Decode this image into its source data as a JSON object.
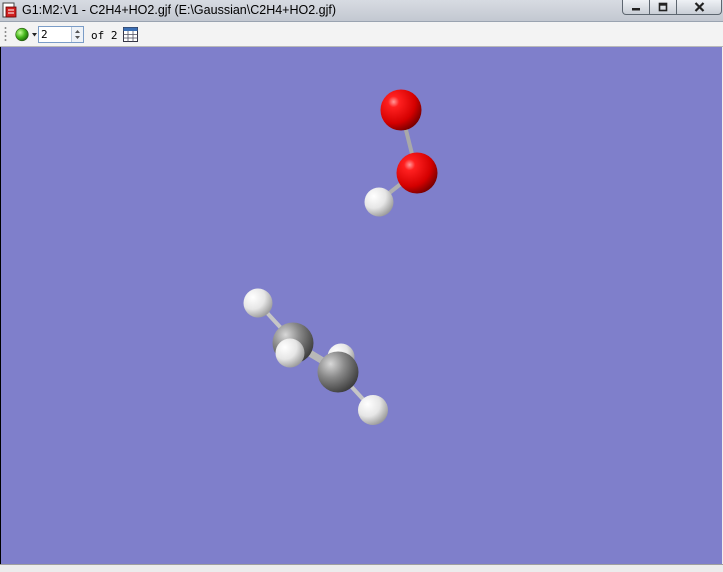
{
  "window": {
    "title": "G1:M2:V1 - C2H4+HO2.gjf (E:\\Gaussian\\C2H4+HO2.gjf)",
    "app_icon": "gaussview-document-icon",
    "controls": [
      "minimize-icon",
      "maximize-icon",
      "close-icon"
    ]
  },
  "toolbar": {
    "model_selector_icon": "green-ball-icon",
    "current_model": "2",
    "of_label": "of 2",
    "spreadsheet_icon": "spreadsheet-icon"
  },
  "viewport": {
    "background_color": "#7f7fcb",
    "atoms": [
      {
        "element": "O",
        "color": "#e00000"
      },
      {
        "element": "O",
        "color": "#e00000"
      },
      {
        "element": "H",
        "color": "#ffffff"
      },
      {
        "element": "C",
        "color": "#8a8a8a"
      },
      {
        "element": "C",
        "color": "#8a8a8a"
      },
      {
        "element": "H",
        "color": "#ffffff"
      },
      {
        "element": "H",
        "color": "#ffffff"
      },
      {
        "element": "H",
        "color": "#ffffff"
      },
      {
        "element": "H",
        "color": "#ffffff"
      }
    ]
  }
}
